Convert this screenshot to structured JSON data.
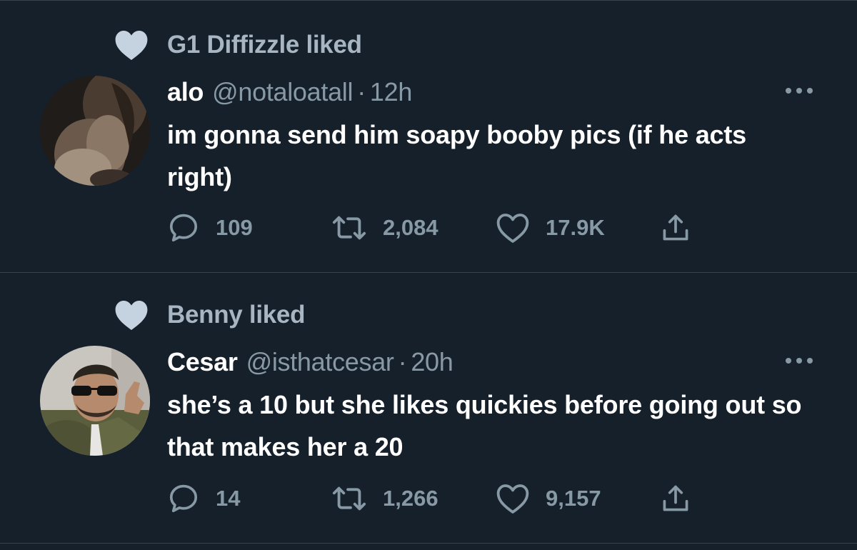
{
  "tweets": [
    {
      "social_context": "G1 Diffizzle liked",
      "author": {
        "name": "alo",
        "handle": "@notaloatall",
        "time": "12h"
      },
      "text": "im gonna send him soapy booby pics (if he acts right)",
      "stats": {
        "replies": "109",
        "retweets": "2,084",
        "likes": "17.9K"
      }
    },
    {
      "social_context": "Benny liked",
      "author": {
        "name": "Cesar",
        "handle": "@isthatcesar",
        "time": "20h"
      },
      "text": "she’s a 10 but she likes quickies before going out so that makes her a 20",
      "stats": {
        "replies": "14",
        "retweets": "1,266",
        "likes": "9,157"
      }
    }
  ],
  "separator": "·",
  "theme": {
    "background": "#15202b",
    "divider": "#38444d",
    "primary_text": "#ffffff",
    "secondary_text": "#8899a6",
    "liked_icon": "#c4d3df"
  },
  "icons": {
    "social_context": "heart-fill-icon",
    "reply": "reply-bubble-icon",
    "retweet": "retweet-icon",
    "like": "heart-outline-icon",
    "share": "share-icon",
    "more": "more-dots-icon"
  }
}
